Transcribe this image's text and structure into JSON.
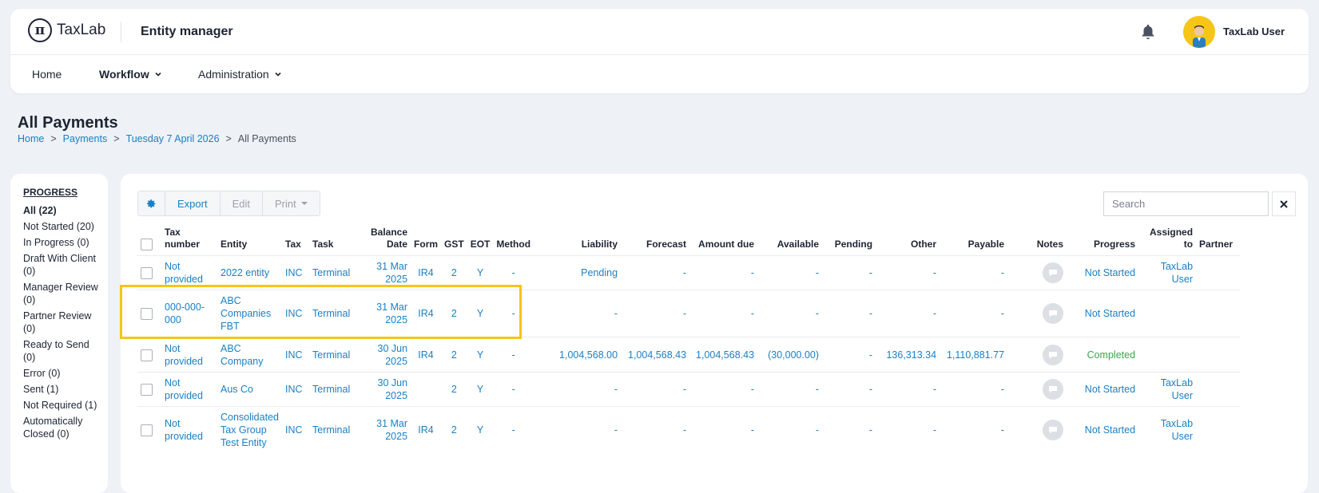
{
  "header": {
    "logo_mark": "π",
    "logo_text": "TaxLab",
    "app_title": "Entity manager",
    "user_name": "TaxLab User"
  },
  "nav": {
    "home": "Home",
    "workflow": "Workflow",
    "administration": "Administration"
  },
  "page": {
    "title": "All Payments",
    "breadcrumb": [
      "Home",
      "Payments",
      "Tuesday 7 April 2026",
      "All Payments"
    ],
    "breadcrumb_sep": ">"
  },
  "progress": {
    "heading": "PROGRESS",
    "items": [
      "All (22)",
      "Not Started (20)",
      "In Progress (0)",
      "Draft With Client (0)",
      "Manager Review (0)",
      "Partner Review (0)",
      "Ready to Send (0)",
      "Error (0)",
      "Sent (1)",
      "Not Required (1)",
      "Automatically Closed (0)"
    ]
  },
  "toolbar": {
    "export": "Export",
    "edit": "Edit",
    "print": "Print",
    "search_placeholder": "Search"
  },
  "table": {
    "headers": [
      "",
      "Tax number",
      "Entity",
      "Tax",
      "Task",
      "Balance Date",
      "Form",
      "GST",
      "EOT",
      "Method",
      "Liability",
      "Forecast",
      "Amount due",
      "Available",
      "Pending",
      "Other",
      "Payable",
      "Notes",
      "Progress",
      "Assigned to",
      "Partner"
    ],
    "rows": [
      {
        "tax_number": "Not provided",
        "entity": "2022 entity",
        "tax": "INC",
        "task": "Terminal",
        "balance_date": "31 Mar 2025",
        "form": "IR4",
        "gst": "2",
        "eot": "Y",
        "method": "-",
        "liability": "Pending",
        "forecast": "-",
        "amount_due": "-",
        "available": "-",
        "pending": "-",
        "other": "-",
        "payable": "-",
        "progress": "Not Started",
        "assigned_to": "TaxLab User",
        "partner": ""
      },
      {
        "tax_number": "000-000-000",
        "entity": "ABC Companies FBT",
        "tax": "INC",
        "task": "Terminal",
        "balance_date": "31 Mar 2025",
        "form": "IR4",
        "gst": "2",
        "eot": "Y",
        "method": "-",
        "liability": "-",
        "forecast": "-",
        "amount_due": "-",
        "available": "-",
        "pending": "-",
        "other": "-",
        "payable": "-",
        "progress": "Not Started",
        "assigned_to": "",
        "partner": ""
      },
      {
        "tax_number": "Not provided",
        "entity": "ABC Company",
        "tax": "INC",
        "task": "Terminal",
        "balance_date": "30 Jun 2025",
        "form": "IR4",
        "gst": "2",
        "eot": "Y",
        "method": "-",
        "liability": "1,004,568.00",
        "forecast": "1,004,568.43",
        "amount_due": "1,004,568.43",
        "available": "(30,000.00)",
        "pending": "-",
        "other": "136,313.34",
        "payable": "1,110,881.77",
        "progress": "Completed",
        "assigned_to": "",
        "partner": ""
      },
      {
        "tax_number": "Not provided",
        "entity": "Aus Co",
        "tax": "INC",
        "task": "Terminal",
        "balance_date": "30 Jun 2025",
        "form": "",
        "gst": "2",
        "eot": "Y",
        "method": "-",
        "liability": "-",
        "forecast": "-",
        "amount_due": "-",
        "available": "-",
        "pending": "-",
        "other": "-",
        "payable": "-",
        "progress": "Not Started",
        "assigned_to": "TaxLab User",
        "partner": ""
      },
      {
        "tax_number": "Not provided",
        "entity": "Consolidated Tax Group Test Entity",
        "tax": "INC",
        "task": "Terminal",
        "balance_date": "31 Mar 2025",
        "form": "IR4",
        "gst": "2",
        "eot": "Y",
        "method": "-",
        "liability": "-",
        "forecast": "-",
        "amount_due": "-",
        "available": "-",
        "pending": "-",
        "other": "-",
        "payable": "-",
        "progress": "Not Started",
        "assigned_to": "TaxLab User",
        "partner": ""
      }
    ]
  },
  "colors": {
    "link": "#1a7fc4",
    "completed": "#3aa64a",
    "highlight": "#f5c518"
  }
}
